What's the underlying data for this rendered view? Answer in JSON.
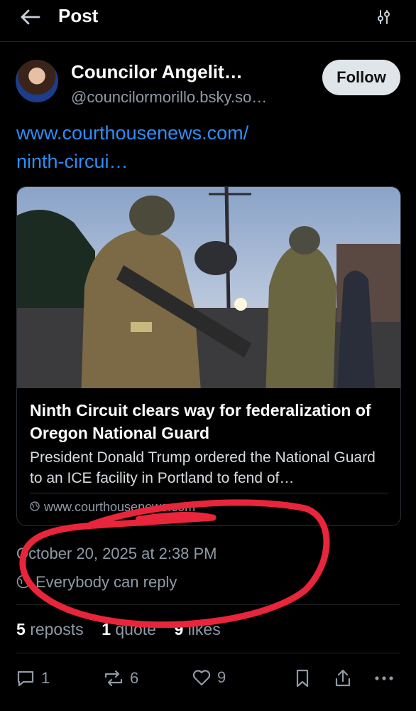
{
  "header": {
    "title": "Post"
  },
  "author": {
    "name": "Councilor Angelit…",
    "handle": "@councilormorillo.bsky.so…",
    "follow_label": "Follow"
  },
  "post": {
    "link_line1": "www.courthousenews.com/",
    "link_line2": "ninth-circui…",
    "timestamp": "October 20, 2025 at 2:38 PM",
    "reply_setting": "Everybody can reply"
  },
  "card": {
    "title": "Ninth Circuit clears way for federalization of Oregon National Guard",
    "description": "President Donald Trump ordered the National Guard to an ICE facility in Portland to fend of…",
    "domain": "www.courthousenews.com"
  },
  "stats": {
    "reposts_count": "5",
    "reposts_label": "reposts",
    "quotes_count": "1",
    "quotes_label": "quote",
    "likes_count": "9",
    "likes_label": "likes"
  },
  "actions": {
    "reply_count": "1",
    "repost_count": "6",
    "like_count": "9"
  },
  "colors": {
    "link": "#2f8df6",
    "annotation": "#e8253a"
  }
}
